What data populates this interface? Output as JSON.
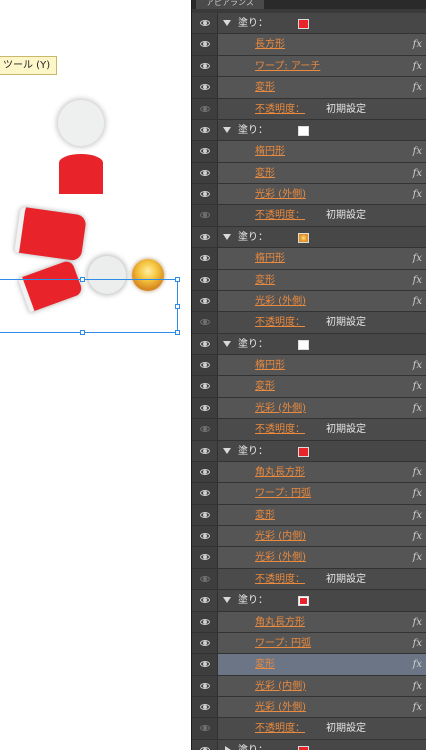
{
  "canvas": {
    "tooltip": "ツール (Y)"
  },
  "panel": {
    "tab_label": "アピアランス",
    "groups": [
      {
        "label": "塗り：",
        "swatch": "red",
        "collapsed": false,
        "items": [
          {
            "label": "長方形",
            "fx": "fx"
          },
          {
            "label": "ワープ: アーチ",
            "fx": "fx"
          },
          {
            "label": "変形",
            "fx": "fx"
          }
        ],
        "opacity": {
          "label": "不透明度：",
          "value": "初期設定"
        }
      },
      {
        "label": "塗り：",
        "swatch": "white",
        "collapsed": false,
        "items": [
          {
            "label": "楕円形",
            "fx": "fx"
          },
          {
            "label": "変形",
            "fx": "fx"
          },
          {
            "label": "光彩 (外側)",
            "fx": "fx"
          }
        ],
        "opacity": {
          "label": "不透明度：",
          "value": "初期設定"
        }
      },
      {
        "label": "塗り：",
        "swatch": "gold",
        "collapsed": false,
        "items": [
          {
            "label": "楕円形",
            "fx": "fx"
          },
          {
            "label": "変形",
            "fx": "fx"
          },
          {
            "label": "光彩 (外側)",
            "fx": "fx"
          }
        ],
        "opacity": {
          "label": "不透明度：",
          "value": "初期設定"
        }
      },
      {
        "label": "塗り：",
        "swatch": "white",
        "collapsed": false,
        "items": [
          {
            "label": "楕円形",
            "fx": "fx"
          },
          {
            "label": "変形",
            "fx": "fx"
          },
          {
            "label": "光彩 (外側)",
            "fx": "fx"
          }
        ],
        "opacity": {
          "label": "不透明度：",
          "value": "初期設定"
        }
      },
      {
        "label": "塗り：",
        "swatch": "red",
        "collapsed": false,
        "items": [
          {
            "label": "角丸長方形",
            "fx": "fx"
          },
          {
            "label": "ワープ: 円弧",
            "fx": "fx"
          },
          {
            "label": "変形",
            "fx": "fx"
          },
          {
            "label": "光彩 (内側)",
            "fx": "fx"
          },
          {
            "label": "光彩 (外側)",
            "fx": "fx"
          }
        ],
        "opacity": {
          "label": "不透明度：",
          "value": "初期設定"
        }
      },
      {
        "label": "塗り：",
        "swatch": "redframe",
        "collapsed": false,
        "items": [
          {
            "label": "角丸長方形",
            "fx": "fx"
          },
          {
            "label": "ワープ: 円弧",
            "fx": "fx"
          },
          {
            "label": "変形",
            "fx": "fx",
            "selected": true
          },
          {
            "label": "光彩 (内側)",
            "fx": "fx"
          },
          {
            "label": "光彩 (外側)",
            "fx": "fx"
          }
        ],
        "opacity": {
          "label": "不透明度：",
          "value": "初期設定"
        }
      },
      {
        "label": "塗り：",
        "swatch": "red",
        "collapsed": true,
        "items": [],
        "opacity": null
      }
    ]
  },
  "colors": {
    "accent_orange": "#e98a3f",
    "selection_blue": "#2e8be8",
    "shape_red": "#e8232a"
  }
}
